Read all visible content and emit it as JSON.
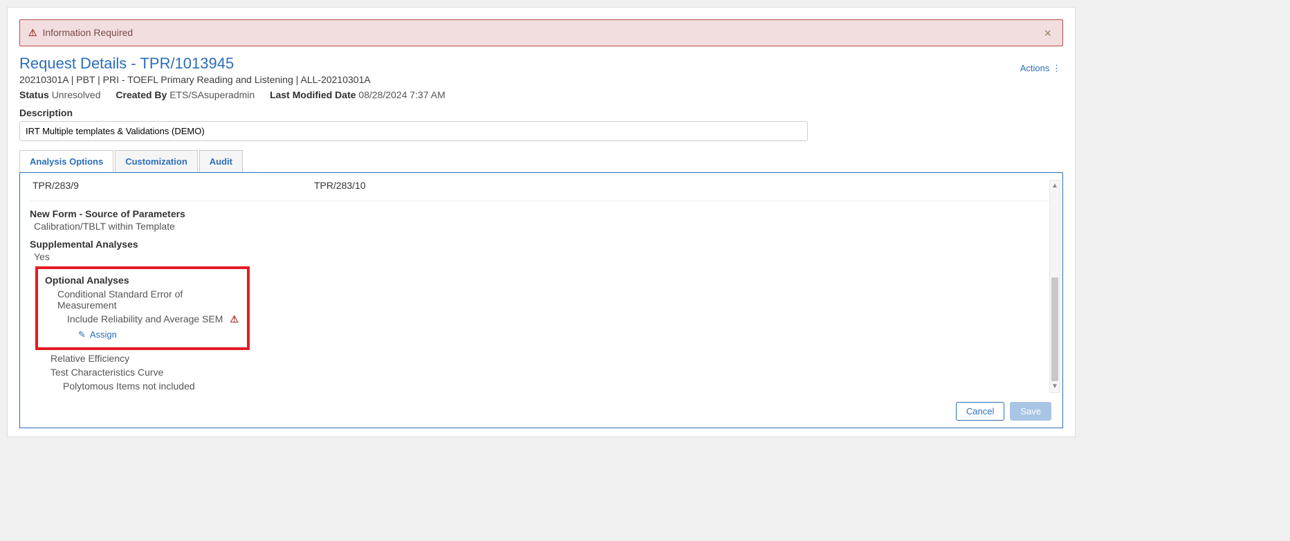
{
  "alert": {
    "text": "Information Required"
  },
  "header": {
    "title": "Request Details - TPR/1013945",
    "breadcrumb": "20210301A | PBT | PRI - TOEFL Primary Reading and Listening | ALL-20210301A",
    "actions_label": "Actions"
  },
  "meta": {
    "status_label": "Status",
    "status_value": "Unresolved",
    "created_by_label": "Created By",
    "created_by_value": "ETS/SAsuperadmin",
    "modified_label": "Last Modified Date",
    "modified_value": "08/28/2024 7:37 AM"
  },
  "description": {
    "label": "Description",
    "value": "IRT Multiple templates & Validations (DEMO)"
  },
  "tabs": {
    "analysis": "Analysis Options",
    "customization": "Customization",
    "audit": "Audit"
  },
  "panel": {
    "col1": "TPR/283/9",
    "col2": "TPR/283/10",
    "new_form_title": "New Form - Source of Parameters",
    "new_form_value": "Calibration/TBLT within Template",
    "supp_title": "Supplemental Analyses",
    "supp_value": "Yes",
    "optional_title": "Optional Analyses",
    "optional_item1": "Conditional Standard Error of Measurement",
    "optional_item2": "Include Reliability and Average SEM",
    "assign_label": "Assign",
    "rel_eff": "Relative Efficiency",
    "tcc": "Test Characteristics Curve",
    "poly": "Polytomous Items not included",
    "cancel": "Cancel",
    "save": "Save"
  }
}
